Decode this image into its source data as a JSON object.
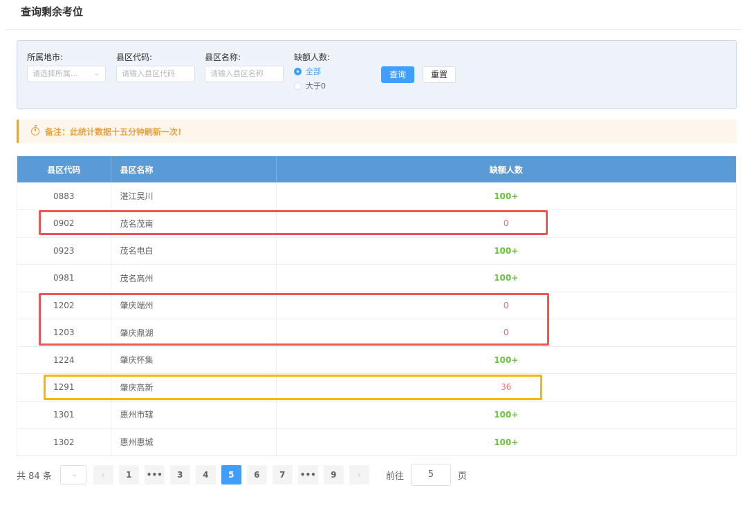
{
  "page": {
    "title": "查询剩余考位"
  },
  "filters": {
    "city": {
      "label": "所属地市:",
      "placeholder": "请选择所属..."
    },
    "code": {
      "label": "县区代码:",
      "placeholder": "请输入县区代码"
    },
    "name": {
      "label": "县区名称:",
      "placeholder": "请输入县区名称"
    },
    "shortage": {
      "label": "缺额人数:",
      "options": [
        "全部",
        "大于0"
      ],
      "selected": "全部"
    },
    "query_label": "查询",
    "reset_label": "重置"
  },
  "notice": {
    "text": "备注：此统计数据十五分钟刷新一次!"
  },
  "table": {
    "headers": [
      "县区代码",
      "县区名称",
      "缺额人数"
    ],
    "rows": [
      {
        "code": "0883",
        "name": "湛江吴川",
        "count": "100+"
      },
      {
        "code": "0902",
        "name": "茂名茂南",
        "count": "0"
      },
      {
        "code": "0923",
        "name": "茂名电白",
        "count": "100+"
      },
      {
        "code": "0981",
        "name": "茂名高州",
        "count": "100+"
      },
      {
        "code": "1202",
        "name": "肇庆端州",
        "count": "0"
      },
      {
        "code": "1203",
        "name": "肇庆鼎湖",
        "count": "0"
      },
      {
        "code": "1224",
        "name": "肇庆怀集",
        "count": "100+"
      },
      {
        "code": "1291",
        "name": "肇庆高新",
        "count": "36"
      },
      {
        "code": "1301",
        "name": "惠州市辖",
        "count": "100+"
      },
      {
        "code": "1302",
        "name": "惠州惠城",
        "count": "100+"
      }
    ]
  },
  "pagination": {
    "total": "共 84 条",
    "prev": "‹",
    "next": "›",
    "pages": [
      "1",
      "•••",
      "3",
      "4",
      "5",
      "6",
      "7",
      "•••",
      "9"
    ],
    "current": "5",
    "goto_label": "前往",
    "goto_value": "5",
    "page_suffix": "页"
  },
  "colors": {
    "header": "#5b9bd5",
    "primary": "#409eff",
    "green": "#67c23a",
    "red": "#f56c6c",
    "warning": "#e6a23c",
    "highlight_red": "#ee5555",
    "highlight_yellow": "#f5b800"
  }
}
